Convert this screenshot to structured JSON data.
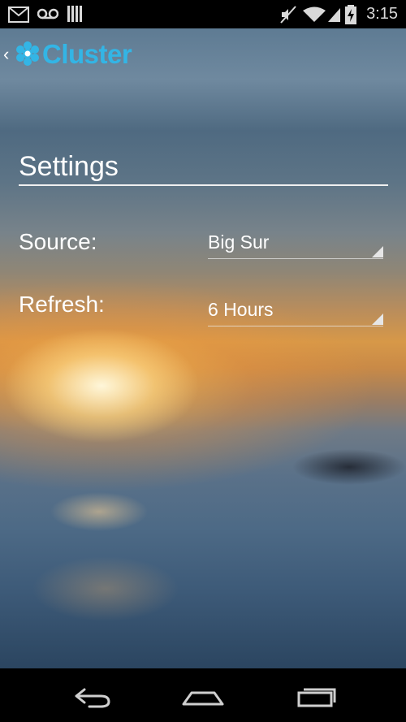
{
  "status_bar": {
    "time": "3:15",
    "icons": [
      "gmail-icon",
      "voicemail-icon",
      "signal-bars-icon",
      "mute-icon",
      "wifi-icon",
      "cell-signal-icon",
      "battery-charging-icon"
    ]
  },
  "action_bar": {
    "app_title": "Cluster",
    "accent_color": "#33b5e5"
  },
  "settings": {
    "title": "Settings",
    "rows": [
      {
        "label": "Source:",
        "value": "Big Sur"
      },
      {
        "label": "Refresh:",
        "value": "6 Hours"
      }
    ]
  },
  "nav_bar": {
    "buttons": [
      "back-icon",
      "home-icon",
      "recent-apps-icon"
    ]
  }
}
